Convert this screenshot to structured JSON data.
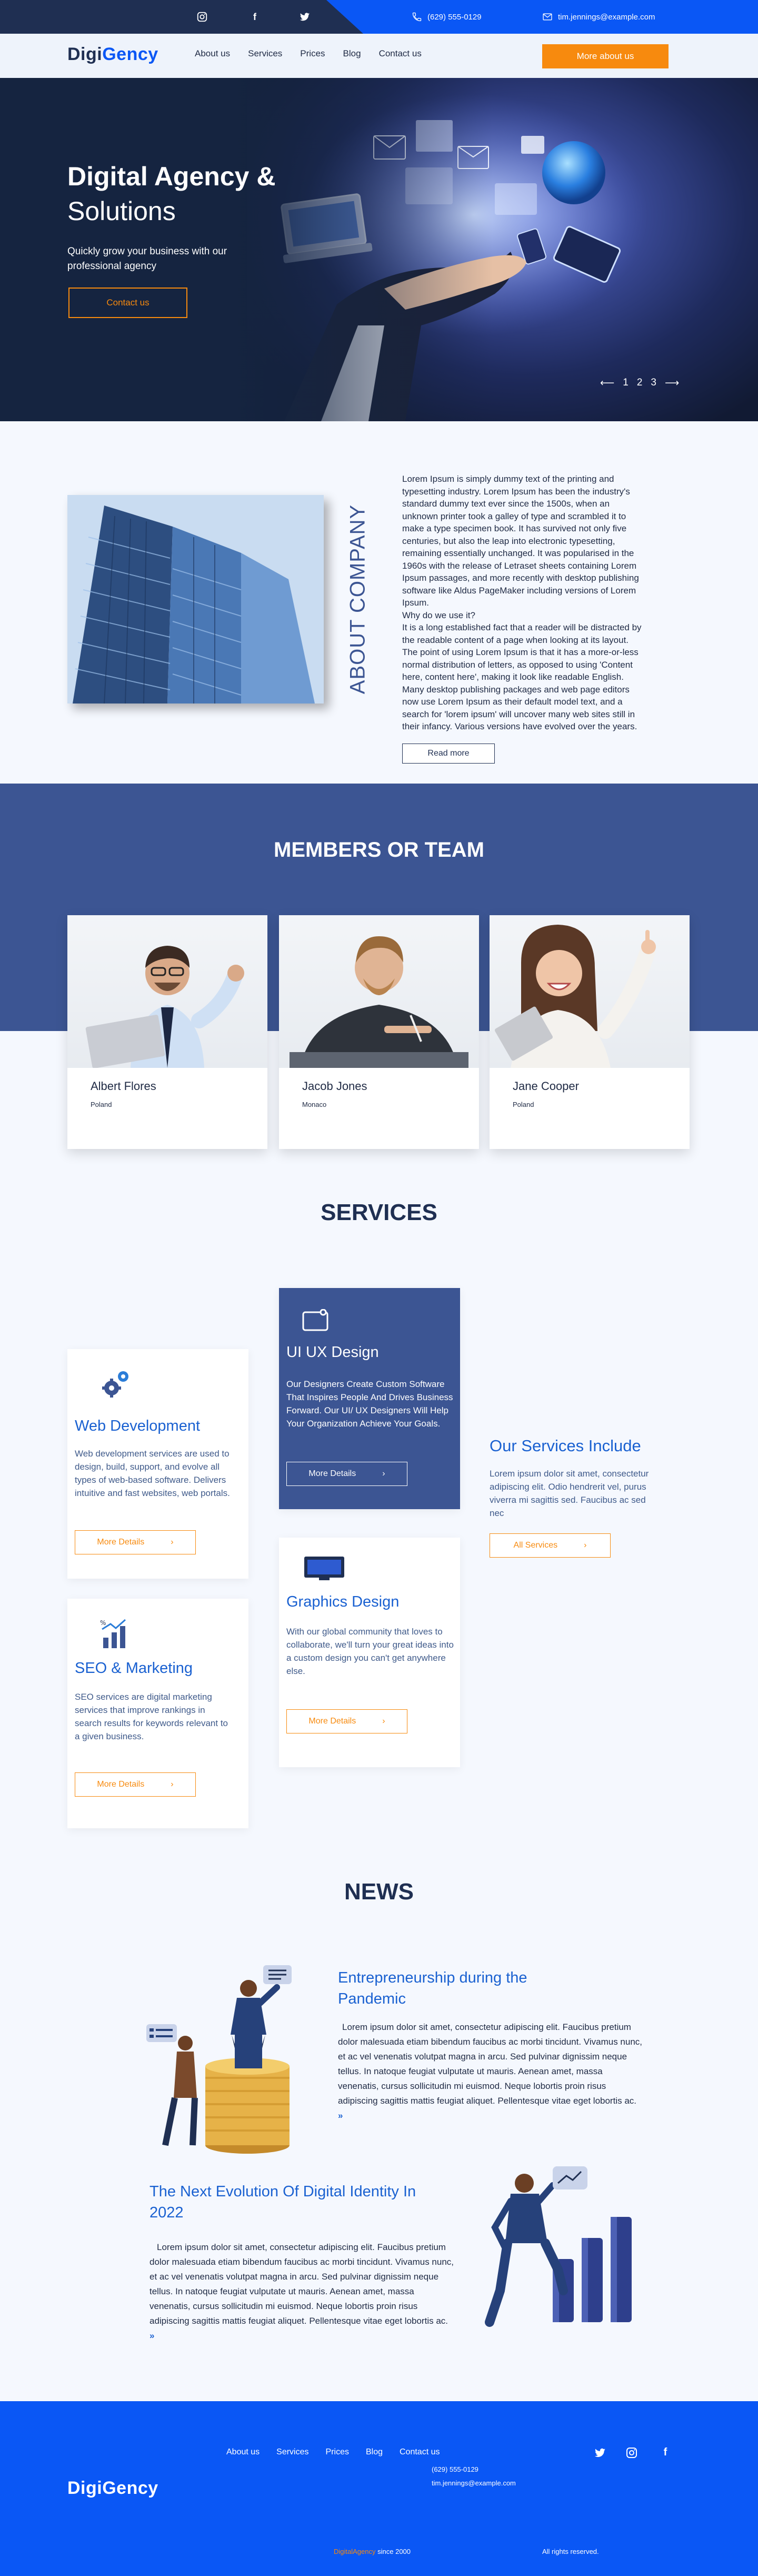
{
  "topbar": {
    "phone": "(629) 555-0129",
    "email": "tim.jennings@example.com"
  },
  "nav": {
    "logo_digi": "Digi",
    "logo_gency": "Gency",
    "links": [
      "About us",
      "Services",
      "Prices",
      "Blog",
      "Contact us"
    ],
    "cta": "More about us"
  },
  "hero": {
    "title_bold": "Digital Agency &",
    "title_light": "Solutions",
    "subtitle": "Quickly grow your business with our professional agency",
    "cta": "Contact us",
    "pager_arrow_left": "⟵",
    "pager": [
      "1",
      "2",
      "3"
    ],
    "pager_arrow_right": "⟶"
  },
  "about": {
    "vertical_title": "ABOUT COMPANY",
    "text": "Lorem Ipsum is simply dummy text of the printing and typesetting industry. Lorem Ipsum has been the industry's standard dummy text ever since the 1500s, when an unknown printer took a galley of type and scrambled it to make a type specimen book. It has survived not only five centuries, but also the leap into electronic typesetting, remaining essentially unchanged. It was popularised in the 1960s with the release of Letraset sheets containing Lorem Ipsum passages, and more recently with desktop publishing software like Aldus PageMaker including versions of Lorem Ipsum.",
    "question": "Why do we use it?",
    "text2": "It is a long established fact that a reader will be distracted by the readable content of a page when looking at its layout. The point of using Lorem Ipsum is that it has a more-or-less normal distribution of letters, as opposed to using 'Content here, content here', making it look like readable English. Many desktop publishing packages and web page editors now use Lorem Ipsum as their default model text, and a search for 'lorem ipsum' will uncover many web sites still in their infancy. Various versions have evolved over the years.",
    "cta": "Read more"
  },
  "team": {
    "title": "MEMBERS OR TEAM",
    "members": [
      {
        "name": "Albert Flores",
        "location": "Poland"
      },
      {
        "name": "Jacob Jones",
        "location": "Monaco"
      },
      {
        "name": "Jane Cooper",
        "location": "Poland"
      }
    ]
  },
  "services": {
    "title": "SERVICES",
    "web": {
      "title": "Web Development",
      "text": "Web development services are used to design, build, support, and evolve all types of web-based software. Delivers intuitive and fast websites, web portals.",
      "cta": "More Details"
    },
    "uiux": {
      "title": "UI UX Design",
      "text": "Our Designers Create Custom Software That Inspires People And Drives Business Forward. Our UI/ UX Designers Will Help Your Organization Achieve Your Goals.",
      "cta": "More Details"
    },
    "graphics": {
      "title": "Graphics Design",
      "text": "With our global community that loves to collaborate, we'll turn your great ideas into a custom design you can't get anywhere else.",
      "cta": "More Details"
    },
    "seo": {
      "title": "SEO & Marketing",
      "text": "SEO services are digital marketing services that improve rankings in search results for keywords relevant to a given business.",
      "cta": "More Details"
    },
    "include": {
      "title": "Our Services Include",
      "text": "Lorem ipsum dolor sit amet, consectetur adipiscing elit. Odio hendrerit vel, purus viverra mi sagittis sed. Faucibus ac sed nec",
      "cta": "All Services"
    }
  },
  "news": {
    "title": "NEWS",
    "items": [
      {
        "title": "Entrepreneurship during the Pandemic",
        "text": "Lorem ipsum dolor sit amet, consectetur adipiscing elit. Faucibus pretium dolor malesuada etiam bibendum faucibus ac morbi tincidunt. Vivamus nunc, et ac vel venenatis volutpat magna in arcu. Sed pulvinar dignissim neque tellus. In natoque feugiat vulputate ut mauris. Aenean amet, massa venenatis, cursus sollicitudin mi euismod. Neque lobortis proin risus adipiscing sagittis mattis feugiat aliquet. Pellentesque vitae eget lobortis ac."
      },
      {
        "title": "The Next Evolution Of Digital Identity In 2022",
        "text": "Lorem ipsum dolor sit amet, consectetur adipiscing elit. Faucibus pretium dolor malesuada etiam bibendum faucibus ac morbi tincidunt. Vivamus nunc, et ac vel venenatis volutpat magna in arcu. Sed pulvinar dignissim neque tellus. In natoque feugiat vulputate ut mauris. Aenean amet, massa venenatis, cursus sollicitudin mi euismod. Neque lobortis proin risus adipiscing sagittis mattis feugiat aliquet. Pellentesque vitae eget lobortis ac."
      }
    ]
  },
  "footer": {
    "links": [
      "About us",
      "Services",
      "Prices",
      "Blog",
      "Contact us"
    ],
    "phone": "(629) 555-0129",
    "email": "tim.jennings@example.com",
    "logo_digi": "Digi",
    "logo_gency": "Gency",
    "copyright_brand": "DigitalAgency",
    "copyright_since": "since 2000",
    "rights": "All rights reserved."
  },
  "colors": {
    "primary_blue": "#0a57f5",
    "navy": "#1f2f52",
    "accent_orange": "#f78a0e",
    "band_blue": "#3c5593"
  },
  "icons": [
    "instagram-icon",
    "facebook-icon",
    "twitter-icon",
    "phone-icon",
    "mail-icon",
    "chevron-right-icon"
  ]
}
